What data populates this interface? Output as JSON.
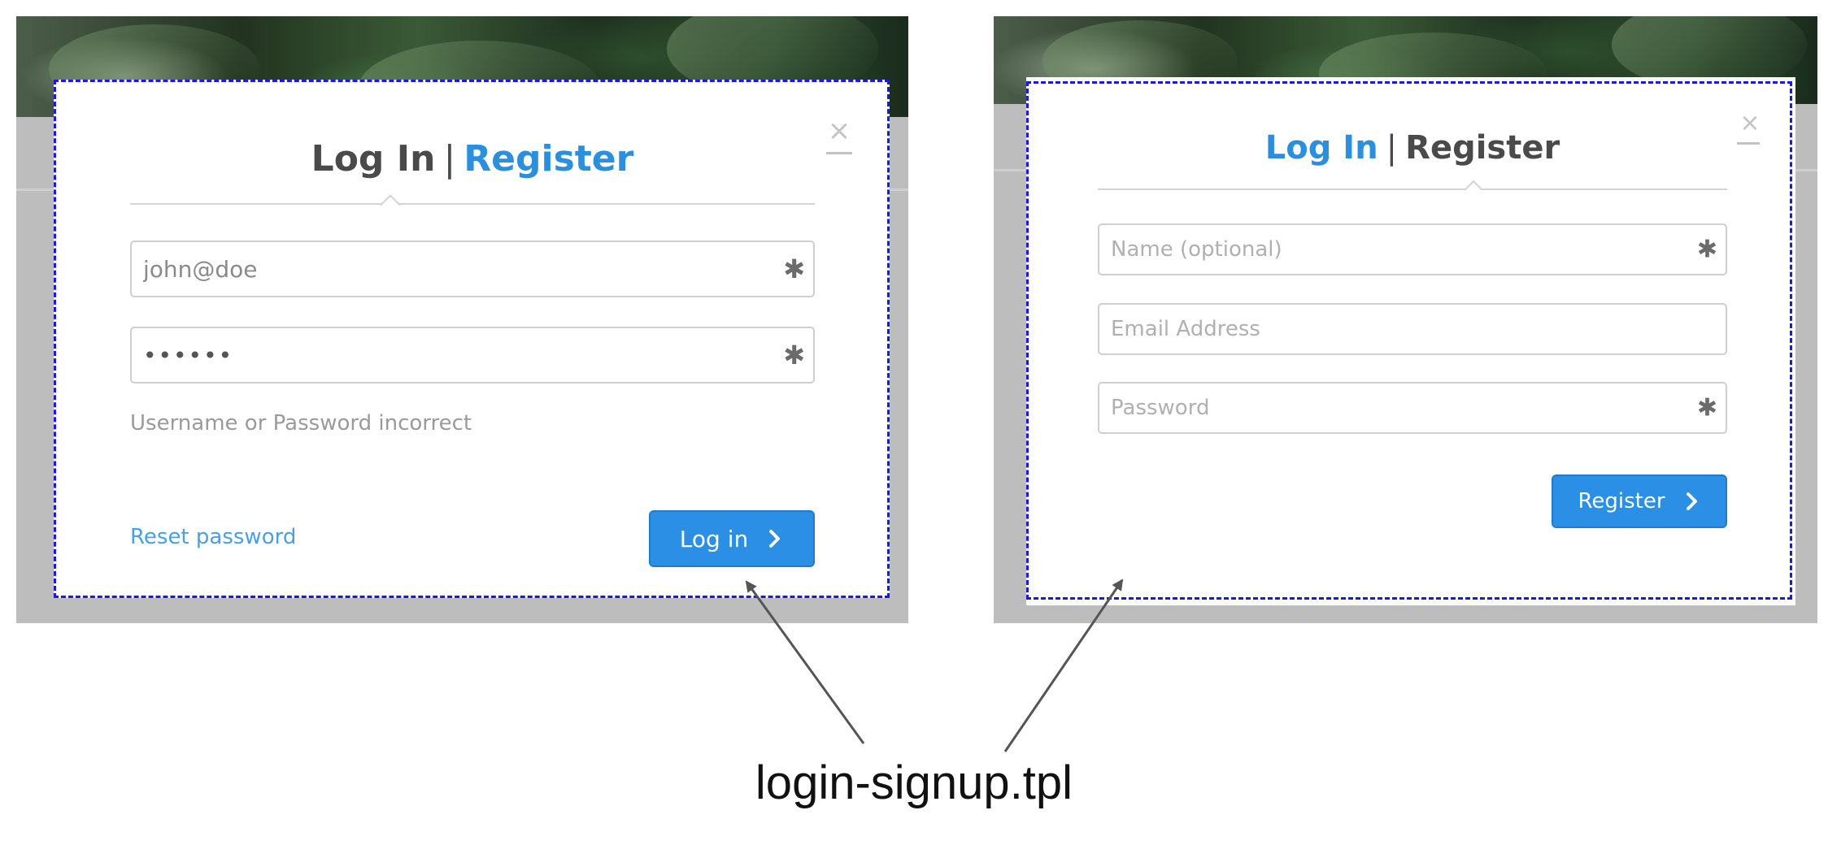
{
  "login_modal": {
    "tab_login": "Log In",
    "tab_separator": "|",
    "tab_register": "Register",
    "close": "×",
    "username_value": "john@doe",
    "password_value": "••••••",
    "required_mark": "✱",
    "error_text": "Username or Password incorrect",
    "reset_link": "Reset password",
    "submit_label": "Log in"
  },
  "register_modal": {
    "tab_login": "Log In",
    "tab_separator": "|",
    "tab_register": "Register",
    "close": "×",
    "name_placeholder": "Name (optional)",
    "email_placeholder": "Email Address",
    "password_placeholder": "Password",
    "required_mark": "✱",
    "submit_label": "Register"
  },
  "annotation": {
    "caption": "login-signup.tpl"
  },
  "colors": {
    "accent": "#2b8fe6",
    "dashed_outline": "#1a1adb",
    "backdrop": "#bdbdbd"
  }
}
